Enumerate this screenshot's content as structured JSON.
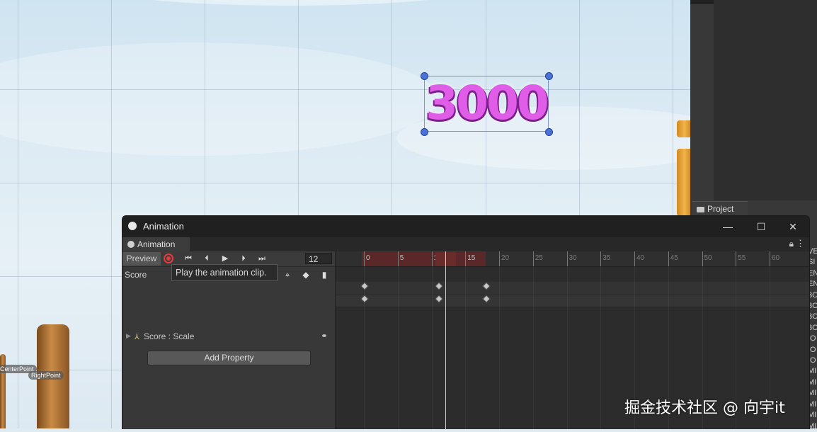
{
  "scene": {
    "score_text": "3000",
    "point_labels": [
      "CenterPoint",
      "RightPoint"
    ],
    "colors": {
      "score_fill": "#e05de8",
      "score_outline": "#7b1f8a",
      "handle": "#4a72d8"
    }
  },
  "right_panel": {
    "project_tab_label": "Project",
    "clipped_letters": [
      "VE",
      "SI",
      "EN",
      "EN",
      "3C",
      "3C",
      "3C",
      "3C",
      "IO",
      "IO",
      "IO",
      "MI",
      "MI",
      "MI",
      "MI",
      "MI",
      "MI",
      "MI"
    ]
  },
  "animation_window": {
    "title": "Animation",
    "tab_label": "Animation",
    "preview_label": "Preview",
    "frame_value": "12",
    "clip_name": "Score",
    "tooltip": "Play the animation clip.",
    "property_name": "Score : Scale",
    "add_property_label": "Add Property",
    "ruler_labels": [
      "0",
      "5",
      "10",
      "15",
      "20",
      "25",
      "30",
      "35",
      "40",
      "45",
      "50",
      "55",
      "60"
    ],
    "keyframes": [
      0,
      11,
      18
    ],
    "current_frame": 12,
    "colors": {
      "record": "#e53b3b",
      "range": "#5a2828"
    }
  },
  "watermark": "掘金技术社区 @ 向宇it"
}
